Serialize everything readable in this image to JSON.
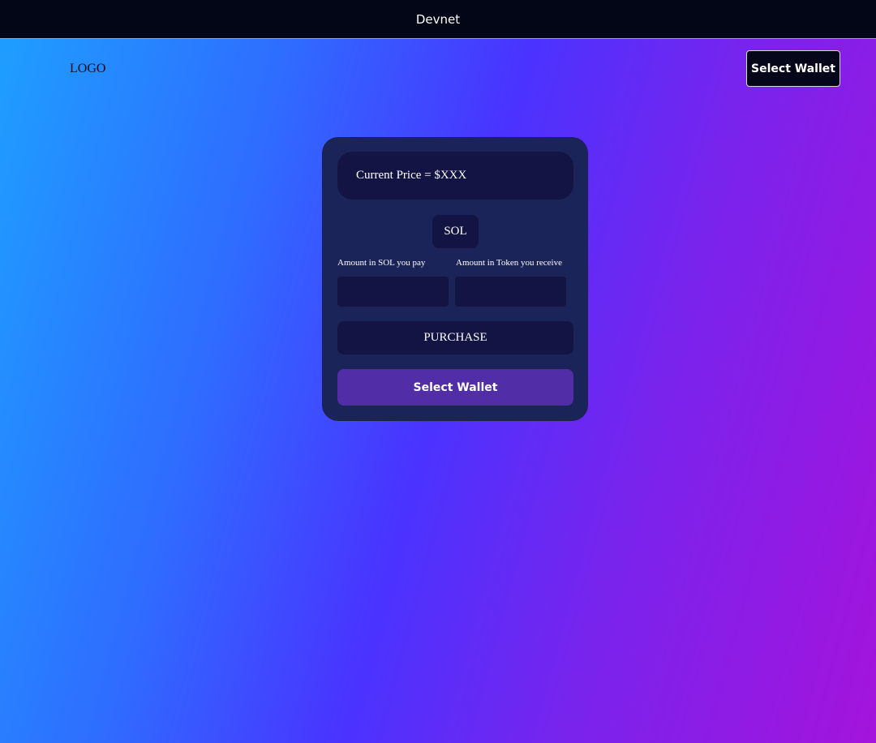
{
  "network_banner": {
    "label": "Devnet"
  },
  "header": {
    "logo": "LOGO",
    "wallet_button": "Select Wallet"
  },
  "purchase_card": {
    "current_price": "Current Price = $XXX",
    "currency": "SOL",
    "pay_label": "Amount in SOL you pay",
    "receive_label": "Amount in Token you receive",
    "pay_value": "",
    "receive_value": "",
    "purchase_button": "PURCHASE",
    "wallet_button": "Select Wallet"
  },
  "colors": {
    "wallet_button_purple": "#512da8",
    "card_background": "#1b2458",
    "field_background": "#141444",
    "banner_background": "#020617"
  }
}
